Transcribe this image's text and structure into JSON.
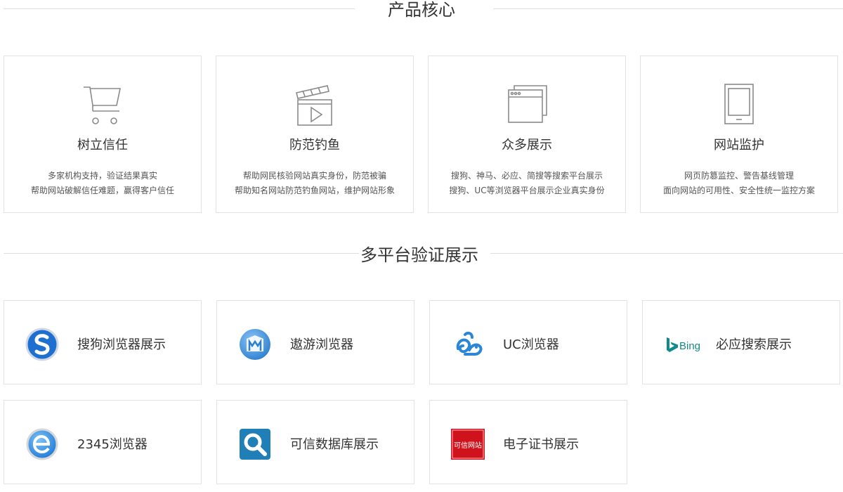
{
  "product_core": {
    "title": "产品核心",
    "cards": [
      {
        "icon": "shopping-cart-icon",
        "title": "树立信任",
        "desc1": "多家机构支持，验证结果真实",
        "desc2": "帮助网站破解信任难题，赢得客户信任"
      },
      {
        "icon": "clapperboard-play-icon",
        "title": "防范钓鱼",
        "desc1": "帮助网民核验网站真实身份，防范被骗",
        "desc2": "帮助知名网站防范钓鱼网站，维护网站形象"
      },
      {
        "icon": "browser-windows-icon",
        "title": "众多展示",
        "desc1": "搜狗、神马、必应、简搜等搜索平台展示",
        "desc2": "搜狗、UC等浏览器平台展示企业真实身份"
      },
      {
        "icon": "tablet-monitor-icon",
        "title": "网站监护",
        "desc1": "网页防篡监控、警告基线管理",
        "desc2": "面向网站的可用性、安全性统一监控方案"
      }
    ]
  },
  "multi_platform": {
    "title": "多平台验证展示",
    "items": [
      {
        "icon": "sogou-logo-icon",
        "label": "搜狗浏览器展示"
      },
      {
        "icon": "maxthon-logo-icon",
        "label": "遨游浏览器"
      },
      {
        "icon": "uc-squirrel-logo-icon",
        "label": "UC浏览器"
      },
      {
        "icon": "bing-logo-icon",
        "label": "必应搜索展示",
        "logo_text": "Bing"
      },
      {
        "icon": "2345-browser-logo-icon",
        "label": "2345浏览器"
      },
      {
        "icon": "magnifier-database-icon",
        "label": "可信数据库展示"
      },
      {
        "icon": "trusted-site-seal-icon",
        "label": "电子证书展示",
        "logo_text": "可信网站"
      }
    ]
  },
  "colors": {
    "border": "#e3e3e3",
    "divider": "#dedede",
    "icon_gray": "#8a8a8a",
    "sogou_blue": "#1f6fd1",
    "uc_blue": "#2a86d6",
    "bing_teal": "#138a8a",
    "database_blue": "#1f7fb6",
    "seal_red": "#d0121c"
  }
}
